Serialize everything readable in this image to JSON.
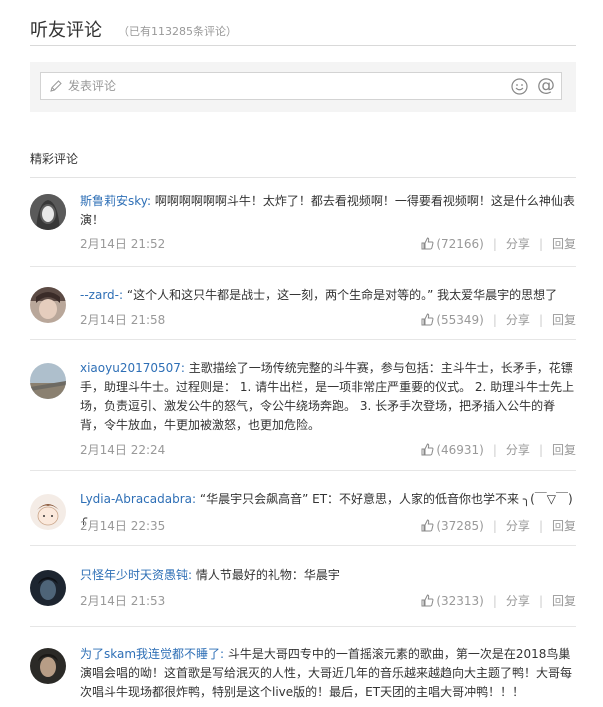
{
  "header": {
    "title": "听友评论",
    "count": "（已有113285条评论）"
  },
  "composer": {
    "placeholder": "发表评论"
  },
  "section": {
    "title": "精彩评论"
  },
  "actions": {
    "share": "分享",
    "reply": "回复"
  },
  "colors": {
    "username": "#2e6fb6",
    "meta": "#999999",
    "divider": "#e6e6e6",
    "composer_bg": "#f4f4f4"
  },
  "icons": [
    "pencil-icon",
    "emoji-icon",
    "at-icon",
    "thumbs-up-icon"
  ],
  "comments": [
    {
      "user": "斯鲁莉安sky:",
      "text": " 啊啊啊啊啊啊斗牛！太炸了！都去看视频啊！一得要看视频啊！这是什么神仙表演！",
      "time": "2月14日 21:52",
      "likes": "(72166)"
    },
    {
      "user": "--zard-:",
      "text": " “这个人和这只牛都是战士，这一刻，两个生命是对等的。” 我太爱华晨宇的思想了",
      "time": "2月14日 21:58",
      "likes": "(55349)"
    },
    {
      "user": "xiaoyu20170507:",
      "text": " 主歌描绘了一场传统完整的斗牛赛，参与包括：主斗牛士，长矛手，花镖手，助理斗牛士。过程则是： 1. 请牛出栏，是一项非常庄严重要的仪式。 2. 助理斗牛士先上场，负责逗引、激发公牛的怒气，令公牛绕场奔跑。 3. 长矛手次登场，把矛插入公牛的脊背，令牛放血，牛更加被激怒，也更加危险。",
      "time": "2月14日 22:24",
      "likes": "(46931)"
    },
    {
      "user": "Lydia-Abracadabra:",
      "text": " “华晨宇只会飙高音” ET：不好意思，人家的低音你也学不来 ╮(￣▽￣)╭",
      "time": "2月14日 22:35",
      "likes": "(37285)"
    },
    {
      "user": "只怪年少时天资愚钝:",
      "text": " 情人节最好的礼物：华晨宇",
      "time": "2月14日 21:53",
      "likes": "(32313)"
    },
    {
      "user": "为了skam我连觉都不睡了:",
      "text": " 斗牛是大哥四专中的一首摇滚元素的歌曲，第一次是在2018鸟巢演唱会唱的呦！这首歌是写给泯灭的人性，大哥近几年的音乐越来越趋向大主题了鸭！大哥每次唱斗牛现场都很炸鸭，特别是这个live版的！最后，ET天团的主唱大哥冲鸭！！！"
    }
  ]
}
